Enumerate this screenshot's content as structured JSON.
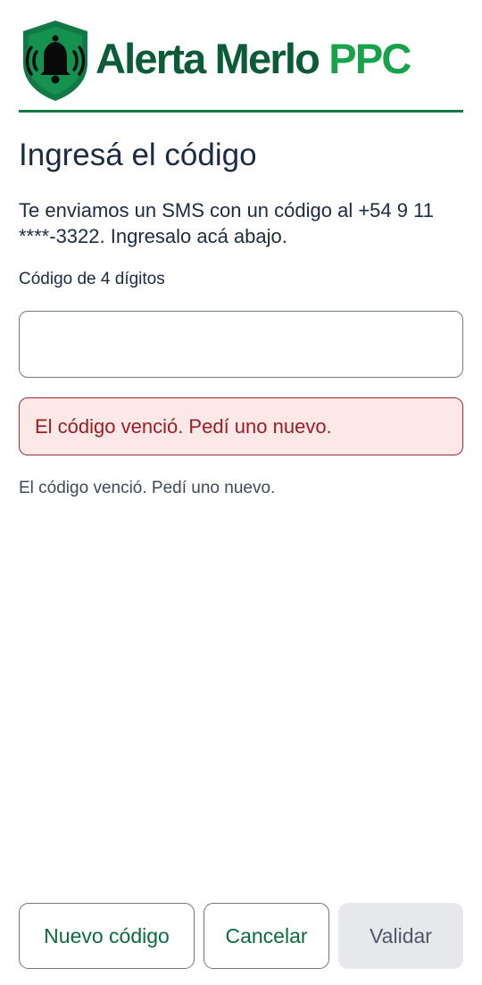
{
  "header": {
    "logo_icon": "shield-bell-icon",
    "brand_main": "Alerta Merlo ",
    "brand_accent": "PPC",
    "colors": {
      "brand_dark": "#0a5b37",
      "brand_accent": "#16a34a",
      "divider": "#0f7a45"
    }
  },
  "main": {
    "title": "Ingresá el código",
    "intro": "Te enviamos un SMS con un código al +54 9 11 ****-3322. Ingresalo acá abajo.",
    "code_label": "Código de 4 dígitos",
    "code_value": "",
    "error_message": "El código venció. Pedí uno nuevo.",
    "helper_text": "El código venció. Pedí uno nuevo.",
    "colors": {
      "error_bg": "#fde8e8",
      "error_border": "#a32b31",
      "error_text": "#9b1c23"
    }
  },
  "actions": {
    "new_code_label": "Nuevo código",
    "cancel_label": "Cancelar",
    "validate_label": "Validar",
    "validate_disabled": true
  }
}
